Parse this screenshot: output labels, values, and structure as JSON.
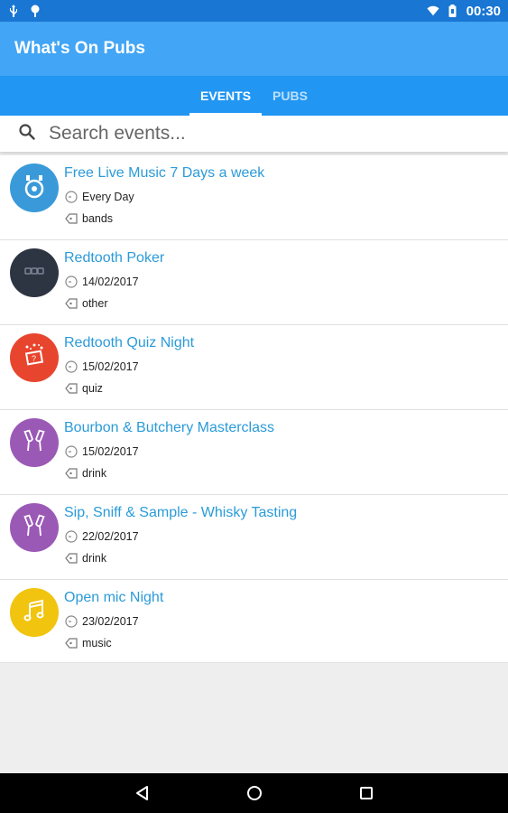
{
  "status_bar": {
    "time": "00:30",
    "left_icons": [
      "usb-icon",
      "location-pin-icon"
    ],
    "right_icons": [
      "wifi-icon",
      "battery-icon"
    ]
  },
  "app_bar": {
    "title": "What's On Pubs"
  },
  "tabs": [
    {
      "label": "EVENTS",
      "active": true
    },
    {
      "label": "PUBS",
      "active": false
    }
  ],
  "search": {
    "placeholder": "Search events...",
    "value": ""
  },
  "events": [
    {
      "title": "Free Live Music 7 Days a week",
      "date": "Every Day",
      "category": "bands",
      "icon": "bands-icon",
      "color": "#3a9ad9"
    },
    {
      "title": "Redtooth Poker",
      "date": "14/02/2017",
      "category": "other",
      "icon": "other-icon",
      "color": "#2e3542"
    },
    {
      "title": "Redtooth Quiz Night",
      "date": "15/02/2017",
      "category": "quiz",
      "icon": "quiz-icon",
      "color": "#e8452e"
    },
    {
      "title": "Bourbon & Butchery Masterclass",
      "date": "15/02/2017",
      "category": "drink",
      "icon": "drink-icon",
      "color": "#9b59b6"
    },
    {
      "title": "Sip, Sniff & Sample - Whisky Tasting",
      "date": "22/02/2017",
      "category": "drink",
      "icon": "drink-icon",
      "color": "#9b59b6"
    },
    {
      "title": "Open mic Night",
      "date": "23/02/2017",
      "category": "music",
      "icon": "music-icon",
      "color": "#f1c40f"
    }
  ],
  "nav_bar": {
    "buttons": [
      "back-icon",
      "home-icon",
      "recents-icon"
    ]
  },
  "colors": {
    "status_bar": "#1976d2",
    "app_bar": "#42a5f5",
    "tabs": "#2196f3",
    "title_link": "#2b9bd8"
  }
}
